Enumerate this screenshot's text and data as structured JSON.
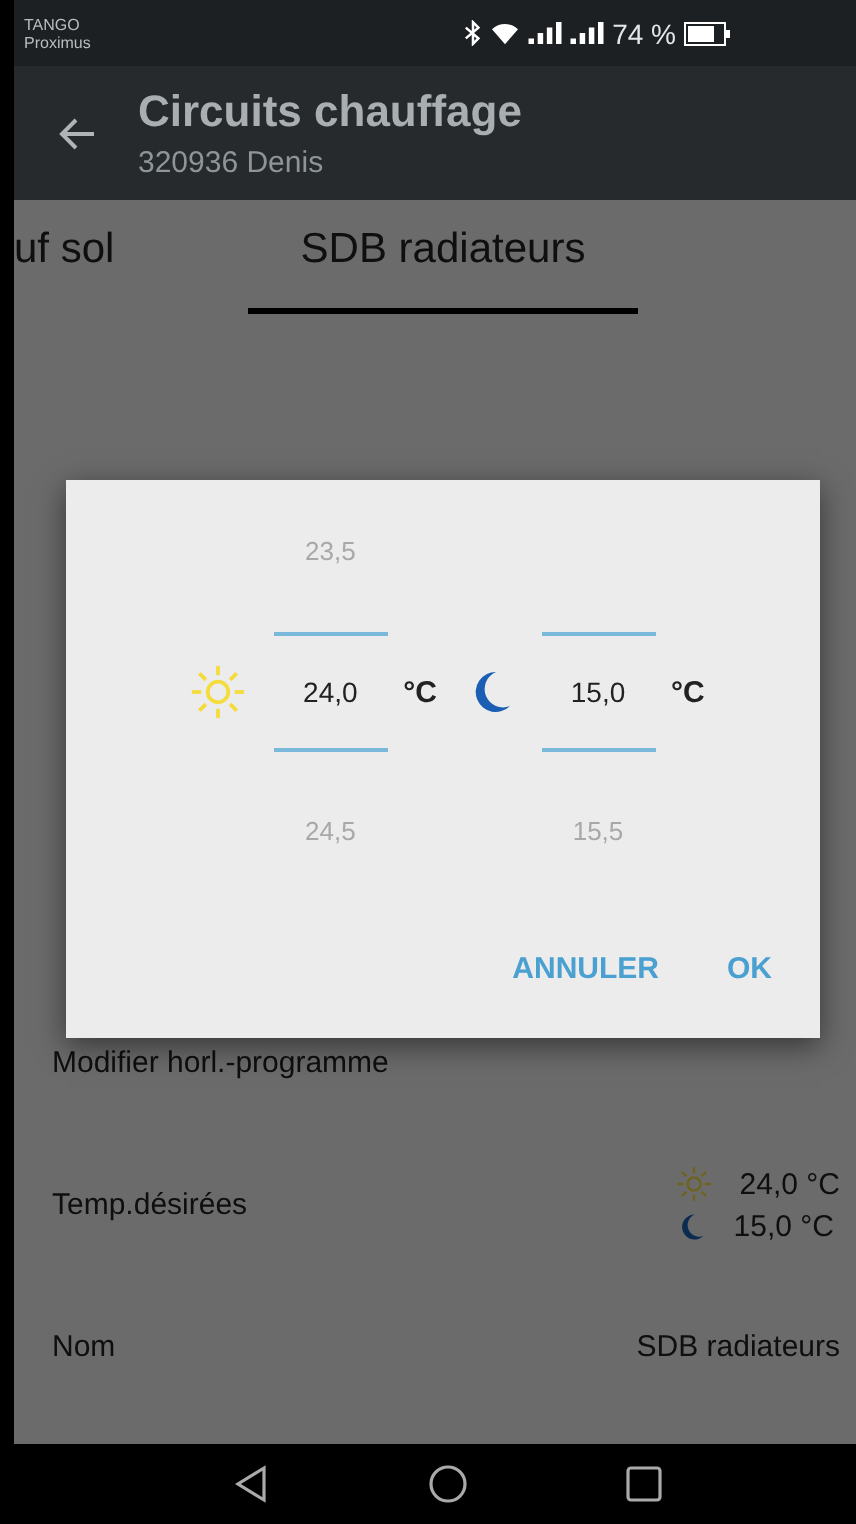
{
  "status_bar": {
    "carrier": "TANGO",
    "carrier_sub": "Proximus",
    "battery": "74 %"
  },
  "toolbar": {
    "title": "Circuits chauffage",
    "subtitle": "320936 Denis"
  },
  "tabs": [
    {
      "label": "uf sol",
      "selected": false
    },
    {
      "label": "SDB radiateurs",
      "selected": true
    }
  ],
  "rows": [
    {
      "kind": "action",
      "label": "Modifier horl.-programme"
    },
    {
      "kind": "temps",
      "label": "Temp.désirées",
      "day": "24,0 °C",
      "night": "15,0 °C"
    },
    {
      "kind": "value",
      "label": "Nom",
      "value": "SDB radiateurs"
    }
  ],
  "dialog": {
    "pickers": [
      {
        "kind": "day",
        "above": "23,5",
        "value": "24,0",
        "unit": "°C",
        "below": "24,5"
      },
      {
        "kind": "night",
        "value": "15,0",
        "unit": "°C",
        "below": "15,5"
      }
    ],
    "buttons": [
      "ANNULER",
      "OK"
    ]
  }
}
